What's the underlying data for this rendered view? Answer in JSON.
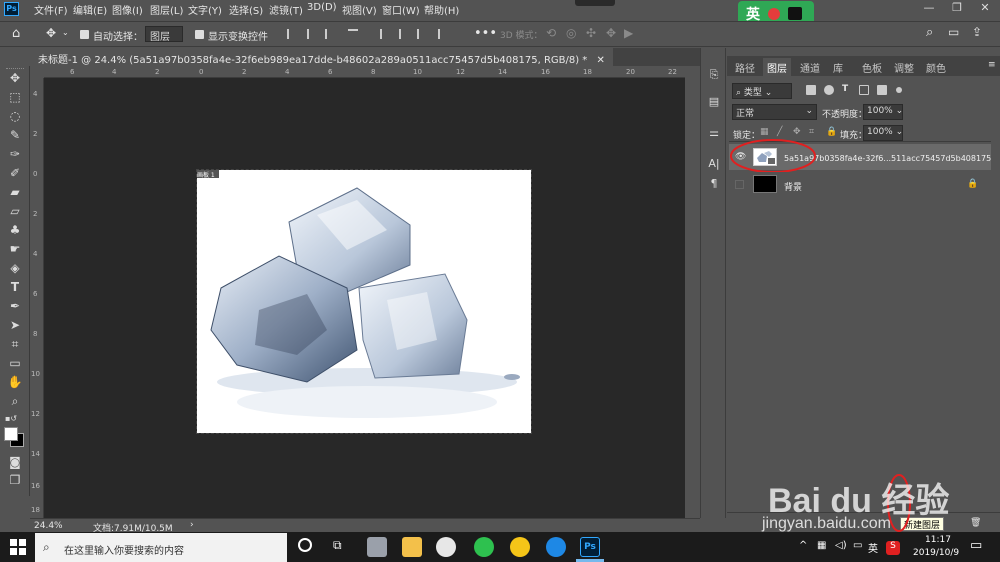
{
  "app": {
    "logo": "Ps"
  },
  "menubar": {
    "items": [
      "文件(F)",
      "编辑(E)",
      "图像(I)",
      "图层(L)",
      "文字(Y)",
      "选择(S)",
      "滤镜(T)",
      "3D(D)",
      "视图(V)",
      "窗口(W)",
      "帮助(H)"
    ],
    "ime_label": "英"
  },
  "options": {
    "auto_select_label": "自动选择：",
    "auto_select_target": "图层",
    "show_transform_label": "显示变换控件",
    "mode_3d_label": "3D 模式："
  },
  "document": {
    "tab_title": "未标题-1 @ 24.4% (5a51a97b0358fa4e-32f6eb989ea17dde-b48602a289a0511acc75457d5b408175, RGB/8) *",
    "artboard_label": "画板 1",
    "ruler_top_ticks": [
      "6",
      "4",
      "2",
      "0",
      "2",
      "4",
      "6",
      "8",
      "10",
      "12",
      "14",
      "16",
      "18",
      "20",
      "22"
    ],
    "ruler_left_ticks": [
      "4",
      "2",
      "0",
      "2",
      "4",
      "6",
      "8",
      "10",
      "12",
      "14",
      "16",
      "18"
    ]
  },
  "status": {
    "zoom": "24.4%",
    "doc_size": "文档:7.91M/10.5M"
  },
  "layers_panel": {
    "tabs": [
      "路径",
      "图层",
      "通道",
      "库",
      "色板",
      "调整",
      "颜色"
    ],
    "active_tab": "图层",
    "filter_kind": "类型",
    "blend_mode": "正常",
    "opacity_label": "不透明度：",
    "opacity_value": "100%",
    "lock_label": "锁定：",
    "fill_label": "填充：",
    "fill_value": "100%",
    "layers": [
      {
        "name": "5a51a97b0358fa4e-32f6...511acc75457d5b408175",
        "visible": true,
        "selected": true
      },
      {
        "name": "背景",
        "visible": false,
        "locked": true
      }
    ],
    "tooltip": "新建图层"
  },
  "taskbar": {
    "search_placeholder": "在这里输入你要搜索的内容",
    "ime": "英",
    "time": "11:17",
    "date": "2019/10/9"
  },
  "watermark": {
    "logo": "Bai du 经验",
    "url": "jingyan.baidu.com"
  },
  "colors": {
    "chrome": "#535353",
    "canvas_bg": "#282828",
    "accent": "#31a8ff",
    "annotation": "#e02020"
  }
}
